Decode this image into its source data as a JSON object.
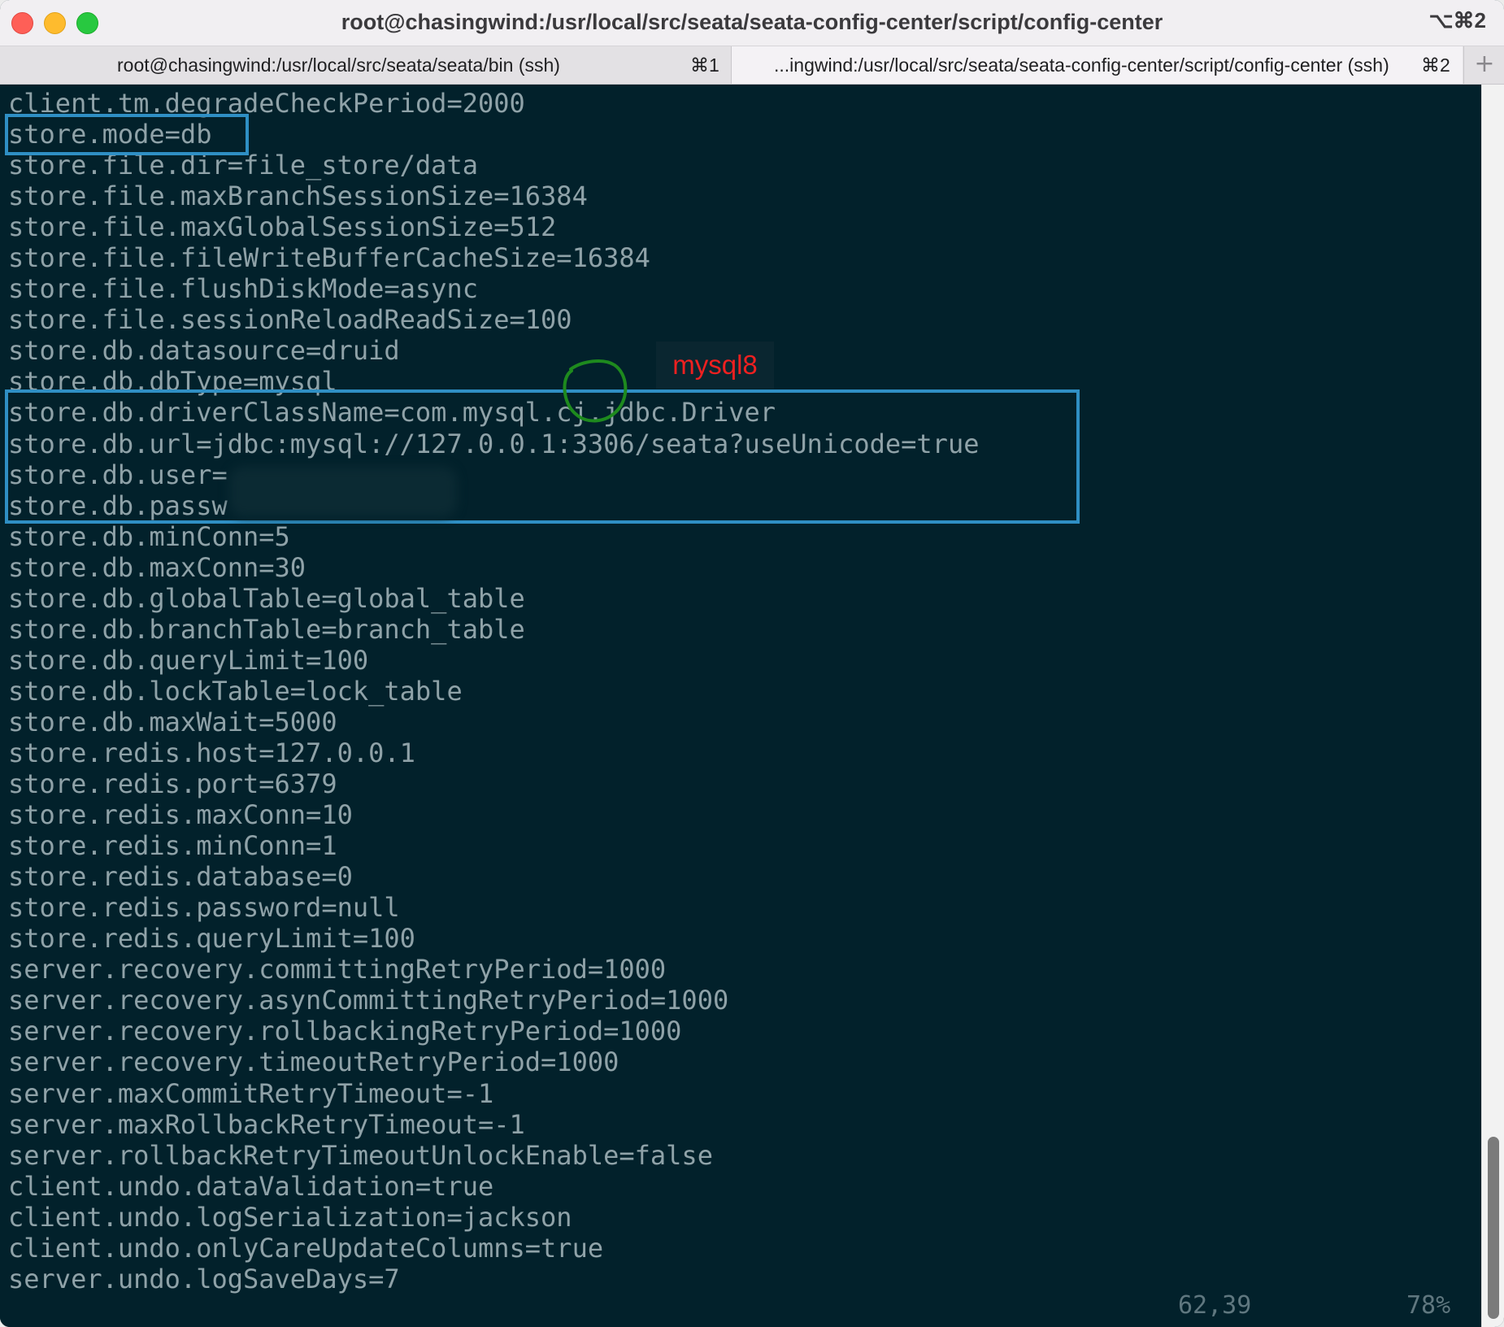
{
  "window": {
    "title": "root@chasingwind:/usr/local/src/seata/seata-config-center/script/config-center",
    "shortcut": "⌥⌘2"
  },
  "tabs": [
    {
      "label": "root@chasingwind:/usr/local/src/seata/seata/bin (ssh)",
      "shortcut": "⌘1"
    },
    {
      "label": "...ingwind:/usr/local/src/seata/seata-config-center/script/config-center (ssh)",
      "shortcut": "⌘2"
    }
  ],
  "new_tab_label": "+",
  "terminal": {
    "lines": [
      "client.tm.degradeCheckPeriod=2000",
      "store.mode=db",
      "store.file.dir=file_store/data",
      "store.file.maxBranchSessionSize=16384",
      "store.file.maxGlobalSessionSize=512",
      "store.file.fileWriteBufferCacheSize=16384",
      "store.file.flushDiskMode=async",
      "store.file.sessionReloadReadSize=100",
      "store.db.datasource=druid",
      "store.db.dbType=mysql",
      "store.db.driverClassName=com.mysql.cj.jdbc.Driver",
      "store.db.url=jdbc:mysql://127.0.0.1:3306/seata?useUnicode=true",
      "store.db.user=",
      "store.db.passw",
      "store.db.minConn=5",
      "store.db.maxConn=30",
      "store.db.globalTable=global_table",
      "store.db.branchTable=branch_table",
      "store.db.queryLimit=100",
      "store.db.lockTable=lock_table",
      "store.db.maxWait=5000",
      "store.redis.host=127.0.0.1",
      "store.redis.port=6379",
      "store.redis.maxConn=10",
      "store.redis.minConn=1",
      "store.redis.database=0",
      "store.redis.password=null",
      "store.redis.queryLimit=100",
      "server.recovery.committingRetryPeriod=1000",
      "server.recovery.asynCommittingRetryPeriod=1000",
      "server.recovery.rollbackingRetryPeriod=1000",
      "server.recovery.timeoutRetryPeriod=1000",
      "server.maxCommitRetryTimeout=-1",
      "server.maxRollbackRetryTimeout=-1",
      "server.rollbackRetryTimeoutUnlockEnable=false",
      "client.undo.dataValidation=true",
      "client.undo.logSerialization=jackson",
      "client.undo.onlyCareUpdateColumns=true",
      "server.undo.logSaveDays=7"
    ],
    "cursor_position": "62,39",
    "scroll_percent": "78%"
  },
  "annotations": {
    "label": "mysql8",
    "label_color": "#ee2020",
    "box_color": "#2f8fc4",
    "circle_color": "#1e8a1e"
  },
  "colors": {
    "terminal_bg": "#02212b",
    "terminal_fg": "#8fa2a8",
    "titlebar_bg": "#f1eff2"
  }
}
